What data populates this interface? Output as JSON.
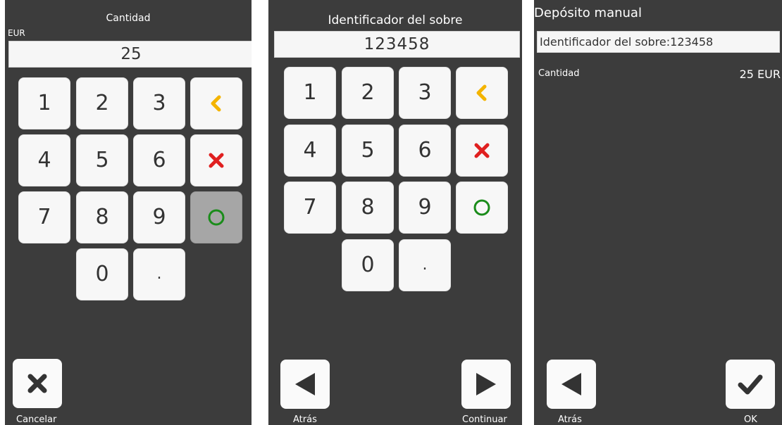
{
  "screen1": {
    "title": "Cantidad",
    "currency": "EUR",
    "amount_value": "25",
    "keys": [
      "1",
      "2",
      "3",
      "4",
      "5",
      "6",
      "7",
      "8",
      "9",
      "0",
      "."
    ],
    "cancel_label": "Cancelar"
  },
  "screen2": {
    "title": "Identificador del sobre",
    "envelope_value": "123458",
    "keys": [
      "1",
      "2",
      "3",
      "4",
      "5",
      "6",
      "7",
      "8",
      "9",
      "0",
      "."
    ],
    "back_label": "Atrás",
    "continue_label": "Continuar"
  },
  "screen3": {
    "title": "Depósito manual",
    "envelope_line": "Identificador del sobre:123458",
    "amount_label": "Cantidad",
    "amount_value": "25 EUR",
    "back_label": "Atrás",
    "ok_label": "OK"
  },
  "colors": {
    "screen_bg": "#3c3c3c",
    "key_bg": "#f7f7f7",
    "back_key": "#f4b400",
    "clear_key": "#e02020",
    "enter_key": "#1a8c1a",
    "icon_dark": "#333333"
  },
  "icons": {
    "backspace": "chevron-left-icon",
    "clear": "cross-icon",
    "enter": "circle-icon",
    "cancel": "x-icon",
    "back": "triangle-left-icon",
    "continue": "triangle-right-icon",
    "ok": "check-icon"
  }
}
